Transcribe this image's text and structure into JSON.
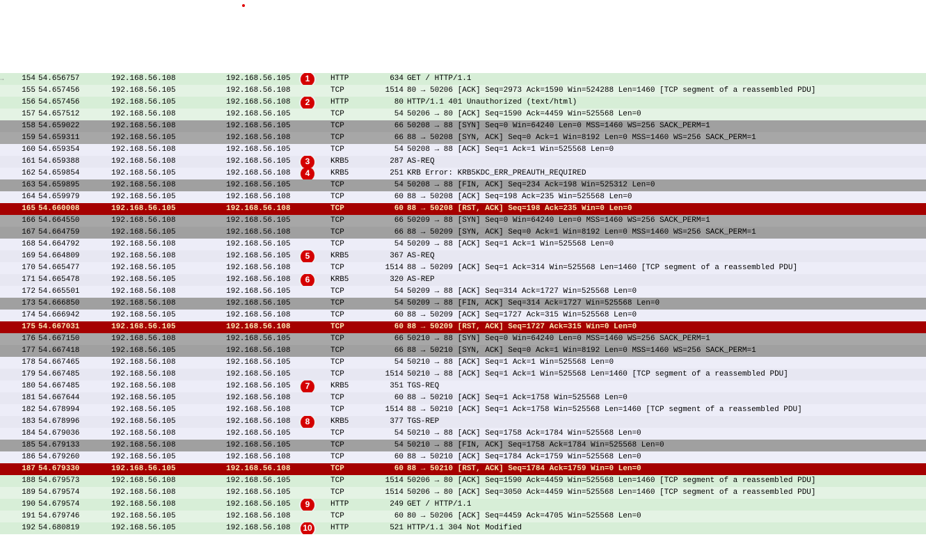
{
  "rows": [
    {
      "no": "154",
      "time": "54.656757",
      "src": "192.168.56.108",
      "dst": "192.168.56.105",
      "proto": "HTTP",
      "len": "634",
      "info": "GET / HTTP/1.1",
      "bg": "bg-http-green2",
      "marker": "1",
      "sel": true
    },
    {
      "no": "155",
      "time": "54.657456",
      "src": "192.168.56.105",
      "dst": "192.168.56.108",
      "proto": "TCP",
      "len": "1514",
      "info": "80 → 50206 [ACK] Seq=2973 Ack=1590 Win=524288 Len=1460 [TCP segment of a reassembled PDU]",
      "bg": "bg-http-green"
    },
    {
      "no": "156",
      "time": "54.657456",
      "src": "192.168.56.105",
      "dst": "192.168.56.108",
      "proto": "HTTP",
      "len": "80",
      "info": "HTTP/1.1 401 Unauthorized  (text/html)",
      "bg": "bg-http-green2",
      "marker": "2"
    },
    {
      "no": "157",
      "time": "54.657512",
      "src": "192.168.56.108",
      "dst": "192.168.56.105",
      "proto": "TCP",
      "len": "54",
      "info": "50206 → 80 [ACK] Seq=1590 Ack=4459 Win=525568 Len=0",
      "bg": "bg-http-green"
    },
    {
      "no": "158",
      "time": "54.659022",
      "src": "192.168.56.108",
      "dst": "192.168.56.105",
      "proto": "TCP",
      "len": "66",
      "info": "50208 → 88 [SYN] Seq=0 Win=64240 Len=0 MSS=1460 WS=256 SACK_PERM=1",
      "bg": "bg-tcp-gray"
    },
    {
      "no": "159",
      "time": "54.659311",
      "src": "192.168.56.105",
      "dst": "192.168.56.108",
      "proto": "TCP",
      "len": "66",
      "info": "88 → 50208 [SYN, ACK] Seq=0 Ack=1 Win=8192 Len=0 MSS=1460 WS=256 SACK_PERM=1",
      "bg": "bg-tcp-gray2"
    },
    {
      "no": "160",
      "time": "54.659354",
      "src": "192.168.56.108",
      "dst": "192.168.56.105",
      "proto": "TCP",
      "len": "54",
      "info": "50208 → 88 [ACK] Seq=1 Ack=1 Win=525568 Len=0",
      "bg": "bg-tcp-light2"
    },
    {
      "no": "161",
      "time": "54.659388",
      "src": "192.168.56.108",
      "dst": "192.168.56.105",
      "proto": "KRB5",
      "len": "287",
      "info": "AS-REQ",
      "bg": "bg-tcp-light",
      "marker": "3"
    },
    {
      "no": "162",
      "time": "54.659854",
      "src": "192.168.56.105",
      "dst": "192.168.56.108",
      "proto": "KRB5",
      "len": "251",
      "info": "KRB Error: KRB5KDC_ERR_PREAUTH_REQUIRED",
      "bg": "bg-tcp-light2",
      "marker": "4"
    },
    {
      "no": "163",
      "time": "54.659895",
      "src": "192.168.56.108",
      "dst": "192.168.56.105",
      "proto": "TCP",
      "len": "54",
      "info": "50208 → 88 [FIN, ACK] Seq=234 Ack=198 Win=525312 Len=0",
      "bg": "bg-tcp-gray"
    },
    {
      "no": "164",
      "time": "54.659979",
      "src": "192.168.56.105",
      "dst": "192.168.56.108",
      "proto": "TCP",
      "len": "60",
      "info": "88 → 50208 [ACK] Seq=198 Ack=235 Win=525568 Len=0",
      "bg": "bg-tcp-light2"
    },
    {
      "no": "165",
      "time": "54.660008",
      "src": "192.168.56.105",
      "dst": "192.168.56.108",
      "proto": "TCP",
      "len": "60",
      "info": "88 → 50208 [RST, ACK] Seq=198 Ack=235 Win=0 Len=0",
      "bg": "bg-red"
    },
    {
      "no": "166",
      "time": "54.664550",
      "src": "192.168.56.108",
      "dst": "192.168.56.105",
      "proto": "TCP",
      "len": "66",
      "info": "50209 → 88 [SYN] Seq=0 Win=64240 Len=0 MSS=1460 WS=256 SACK_PERM=1",
      "bg": "bg-tcp-gray2"
    },
    {
      "no": "167",
      "time": "54.664759",
      "src": "192.168.56.105",
      "dst": "192.168.56.108",
      "proto": "TCP",
      "len": "66",
      "info": "88 → 50209 [SYN, ACK] Seq=0 Ack=1 Win=8192 Len=0 MSS=1460 WS=256 SACK_PERM=1",
      "bg": "bg-tcp-gray"
    },
    {
      "no": "168",
      "time": "54.664792",
      "src": "192.168.56.108",
      "dst": "192.168.56.105",
      "proto": "TCP",
      "len": "54",
      "info": "50209 → 88 [ACK] Seq=1 Ack=1 Win=525568 Len=0",
      "bg": "bg-tcp-light2"
    },
    {
      "no": "169",
      "time": "54.664809",
      "src": "192.168.56.108",
      "dst": "192.168.56.105",
      "proto": "KRB5",
      "len": "367",
      "info": "AS-REQ",
      "bg": "bg-tcp-light",
      "marker": "5"
    },
    {
      "no": "170",
      "time": "54.665477",
      "src": "192.168.56.105",
      "dst": "192.168.56.108",
      "proto": "TCP",
      "len": "1514",
      "info": "88 → 50209 [ACK] Seq=1 Ack=314 Win=525568 Len=1460 [TCP segment of a reassembled PDU]",
      "bg": "bg-tcp-light2"
    },
    {
      "no": "171",
      "time": "54.665478",
      "src": "192.168.56.105",
      "dst": "192.168.56.108",
      "proto": "KRB5",
      "len": "320",
      "info": "AS-REP",
      "bg": "bg-tcp-light",
      "marker": "6"
    },
    {
      "no": "172",
      "time": "54.665501",
      "src": "192.168.56.108",
      "dst": "192.168.56.105",
      "proto": "TCP",
      "len": "54",
      "info": "50209 → 88 [ACK] Seq=314 Ack=1727 Win=525568 Len=0",
      "bg": "bg-tcp-light2"
    },
    {
      "no": "173",
      "time": "54.666850",
      "src": "192.168.56.108",
      "dst": "192.168.56.105",
      "proto": "TCP",
      "len": "54",
      "info": "50209 → 88 [FIN, ACK] Seq=314 Ack=1727 Win=525568 Len=0",
      "bg": "bg-tcp-gray"
    },
    {
      "no": "174",
      "time": "54.666942",
      "src": "192.168.56.105",
      "dst": "192.168.56.108",
      "proto": "TCP",
      "len": "60",
      "info": "88 → 50209 [ACK] Seq=1727 Ack=315 Win=525568 Len=0",
      "bg": "bg-tcp-light2"
    },
    {
      "no": "175",
      "time": "54.667031",
      "src": "192.168.56.105",
      "dst": "192.168.56.108",
      "proto": "TCP",
      "len": "60",
      "info": "88 → 50209 [RST, ACK] Seq=1727 Ack=315 Win=0 Len=0",
      "bg": "bg-red2"
    },
    {
      "no": "176",
      "time": "54.667150",
      "src": "192.168.56.108",
      "dst": "192.168.56.105",
      "proto": "TCP",
      "len": "66",
      "info": "50210 → 88 [SYN] Seq=0 Win=64240 Len=0 MSS=1460 WS=256 SACK_PERM=1",
      "bg": "bg-tcp-gray2"
    },
    {
      "no": "177",
      "time": "54.667418",
      "src": "192.168.56.105",
      "dst": "192.168.56.108",
      "proto": "TCP",
      "len": "66",
      "info": "88 → 50210 [SYN, ACK] Seq=0 Ack=1 Win=8192 Len=0 MSS=1460 WS=256 SACK_PERM=1",
      "bg": "bg-tcp-gray"
    },
    {
      "no": "178",
      "time": "54.667465",
      "src": "192.168.56.108",
      "dst": "192.168.56.105",
      "proto": "TCP",
      "len": "54",
      "info": "50210 → 88 [ACK] Seq=1 Ack=1 Win=525568 Len=0",
      "bg": "bg-tcp-light2"
    },
    {
      "no": "179",
      "time": "54.667485",
      "src": "192.168.56.108",
      "dst": "192.168.56.105",
      "proto": "TCP",
      "len": "1514",
      "info": "50210 → 88 [ACK] Seq=1 Ack=1 Win=525568 Len=1460 [TCP segment of a reassembled PDU]",
      "bg": "bg-tcp-light"
    },
    {
      "no": "180",
      "time": "54.667485",
      "src": "192.168.56.108",
      "dst": "192.168.56.105",
      "proto": "KRB5",
      "len": "351",
      "info": "TGS-REQ",
      "bg": "bg-tcp-light2",
      "marker": "7"
    },
    {
      "no": "181",
      "time": "54.667644",
      "src": "192.168.56.105",
      "dst": "192.168.56.108",
      "proto": "TCP",
      "len": "60",
      "info": "88 → 50210 [ACK] Seq=1 Ack=1758 Win=525568 Len=0",
      "bg": "bg-tcp-light"
    },
    {
      "no": "182",
      "time": "54.678994",
      "src": "192.168.56.105",
      "dst": "192.168.56.108",
      "proto": "TCP",
      "len": "1514",
      "info": "88 → 50210 [ACK] Seq=1 Ack=1758 Win=525568 Len=1460 [TCP segment of a reassembled PDU]",
      "bg": "bg-tcp-light2"
    },
    {
      "no": "183",
      "time": "54.678996",
      "src": "192.168.56.105",
      "dst": "192.168.56.108",
      "proto": "KRB5",
      "len": "377",
      "info": "TGS-REP",
      "bg": "bg-tcp-light",
      "marker": "8"
    },
    {
      "no": "184",
      "time": "54.679036",
      "src": "192.168.56.108",
      "dst": "192.168.56.105",
      "proto": "TCP",
      "len": "54",
      "info": "50210 → 88 [ACK] Seq=1758 Ack=1784 Win=525568 Len=0",
      "bg": "bg-tcp-light2"
    },
    {
      "no": "185",
      "time": "54.679133",
      "src": "192.168.56.108",
      "dst": "192.168.56.105",
      "proto": "TCP",
      "len": "54",
      "info": "50210 → 88 [FIN, ACK] Seq=1758 Ack=1784 Win=525568 Len=0",
      "bg": "bg-tcp-gray"
    },
    {
      "no": "186",
      "time": "54.679260",
      "src": "192.168.56.105",
      "dst": "192.168.56.108",
      "proto": "TCP",
      "len": "60",
      "info": "88 → 50210 [ACK] Seq=1784 Ack=1759 Win=525568 Len=0",
      "bg": "bg-tcp-light2"
    },
    {
      "no": "187",
      "time": "54.679330",
      "src": "192.168.56.105",
      "dst": "192.168.56.108",
      "proto": "TCP",
      "len": "60",
      "info": "88 → 50210 [RST, ACK] Seq=1784 Ack=1759 Win=0 Len=0",
      "bg": "bg-red"
    },
    {
      "no": "188",
      "time": "54.679573",
      "src": "192.168.56.108",
      "dst": "192.168.56.105",
      "proto": "TCP",
      "len": "1514",
      "info": "50206 → 80 [ACK] Seq=1590 Ack=4459 Win=525568 Len=1460 [TCP segment of a reassembled PDU]",
      "bg": "bg-http-green2"
    },
    {
      "no": "189",
      "time": "54.679574",
      "src": "192.168.56.108",
      "dst": "192.168.56.105",
      "proto": "TCP",
      "len": "1514",
      "info": "50206 → 80 [ACK] Seq=3050 Ack=4459 Win=525568 Len=1460 [TCP segment of a reassembled PDU]",
      "bg": "bg-http-green"
    },
    {
      "no": "190",
      "time": "54.679574",
      "src": "192.168.56.108",
      "dst": "192.168.56.105",
      "proto": "HTTP",
      "len": "249",
      "info": "GET / HTTP/1.1",
      "bg": "bg-http-green2",
      "marker": "9"
    },
    {
      "no": "191",
      "time": "54.679746",
      "src": "192.168.56.105",
      "dst": "192.168.56.108",
      "proto": "TCP",
      "len": "60",
      "info": "80 → 50206 [ACK] Seq=4459 Ack=4705 Win=525568 Len=0",
      "bg": "bg-http-green"
    },
    {
      "no": "192",
      "time": "54.680819",
      "src": "192.168.56.105",
      "dst": "192.168.56.108",
      "proto": "HTTP",
      "len": "521",
      "info": "HTTP/1.1 304 Not Modified",
      "bg": "bg-http-green2",
      "marker": "10"
    }
  ]
}
